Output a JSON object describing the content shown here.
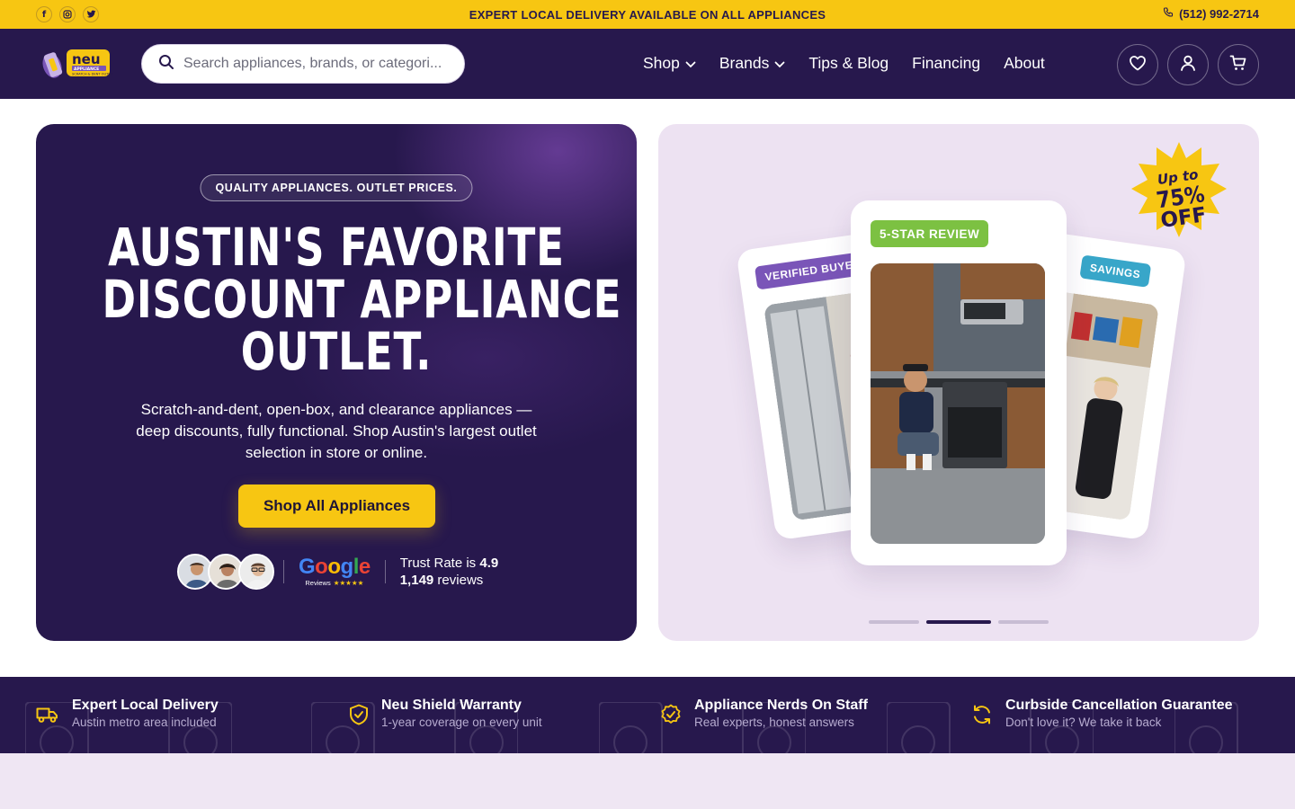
{
  "topbar": {
    "social": [
      "facebook-icon",
      "instagram-icon",
      "twitter-icon"
    ],
    "announcement": "EXPERT LOCAL DELIVERY AVAILABLE ON ALL APPLIANCES",
    "phone": "(512) 992-2714"
  },
  "header": {
    "logo_text": "neu",
    "search_placeholder": "Search appliances, brands, or categori...",
    "nav": [
      {
        "label": "Shop",
        "dropdown": true
      },
      {
        "label": "Brands",
        "dropdown": true
      },
      {
        "label": "Tips & Blog",
        "dropdown": false
      },
      {
        "label": "Financing",
        "dropdown": false
      },
      {
        "label": "About",
        "dropdown": false
      }
    ],
    "icons": [
      "heart-icon",
      "user-icon",
      "cart-icon"
    ]
  },
  "hero": {
    "pill": "QUALITY APPLIANCES. OUTLET PRICES.",
    "headline": [
      "AUSTIN'S FAVORITE",
      "DISCOUNT APPLIANCE",
      "OUTLET."
    ],
    "subtext": "Scratch-and-dent, open-box, and clearance appliances — deep discounts, fully functional. Shop Austin's largest outlet selection in store or online.",
    "cta": "Shop All Appliances",
    "google_word": "Google",
    "google_sub": "Reviews",
    "google_stars": "★★★★★",
    "trust_prefix": "Trust Rate is ",
    "trust_score": "4.9",
    "review_count": "1,149",
    "review_suffix": " reviews"
  },
  "slides": {
    "left_tag": "VERIFIED BUYER",
    "center_tag": "5-STAR REVIEW",
    "right_tag": "SAVINGS",
    "badge_line1": "Up to",
    "badge_line2": "75%",
    "badge_line3": "OFF",
    "active_index": 1,
    "count": 3
  },
  "features": [
    {
      "icon": "truck-icon",
      "title": "Expert Local Delivery",
      "desc": "Austin metro area included"
    },
    {
      "icon": "shield-check-icon",
      "title": "Neu Shield Warranty",
      "desc": "1-year coverage on every unit"
    },
    {
      "icon": "badge-check-icon",
      "title": "Appliance Nerds On Staff",
      "desc": "Real experts, honest answers"
    },
    {
      "icon": "refresh-icon",
      "title": "Curbside Cancellation Guarantee",
      "desc": "Don't love it? We take it back"
    }
  ],
  "colors": {
    "brand_purple": "#27184d",
    "brand_yellow": "#f7c612",
    "tag_green": "#7cc142",
    "tag_violet": "#7a55b8",
    "tag_blue": "#38a6c9"
  }
}
